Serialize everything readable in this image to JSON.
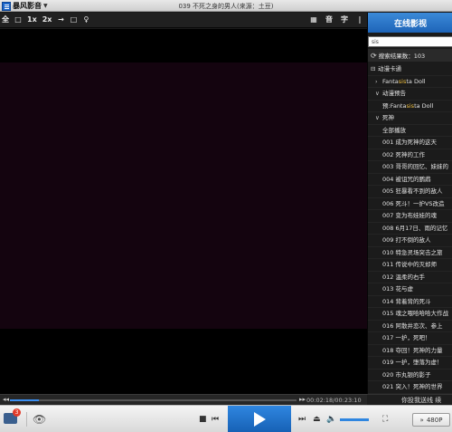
{
  "app": {
    "name": "暴风影音",
    "window_title": "039 不死之身的男人(来源：土豆)"
  },
  "toolbar": {
    "left": [
      "全",
      "□",
      "1x",
      "2x",
      "→",
      "□",
      "♀"
    ],
    "right": [
      "▦",
      "音",
      "字",
      "|"
    ]
  },
  "sidebar": {
    "online_button": "在线影视",
    "search_value": "sis",
    "result_text": "搜索结果数：103",
    "list": [
      {
        "type": "cat",
        "arrow": "⊟",
        "label": "动漫卡通"
      },
      {
        "type": "sub",
        "arrow": "›",
        "pre": "Fanta",
        "hl": "sis",
        "post": "ta Doll"
      },
      {
        "type": "sub",
        "arrow": "∨",
        "label": "动漫预告"
      },
      {
        "type": "item",
        "arrow": "",
        "pre": "预:Fanta",
        "hl": "sis",
        "post": "ta Doll"
      },
      {
        "type": "sub",
        "arrow": "∨",
        "label": "死神"
      },
      {
        "type": "item",
        "arrow": "",
        "label": "全部播放"
      },
      {
        "type": "ep",
        "label": "001 成为死神的这天"
      },
      {
        "type": "ep",
        "label": "002 死神的工作"
      },
      {
        "type": "ep",
        "label": "003 哥哥的回忆、妹妹的"
      },
      {
        "type": "ep",
        "label": "004 被诅咒的鹦鹉"
      },
      {
        "type": "ep",
        "label": "005 狂暴看不到的敌人"
      },
      {
        "type": "ep",
        "label": "006 死斗！一护VS改造"
      },
      {
        "type": "ep",
        "label": "007 变为布娃娃的魂"
      },
      {
        "type": "ep",
        "label": "008 6月17日、雨的记忆"
      },
      {
        "type": "ep",
        "label": "009 打不倒的敌人"
      },
      {
        "type": "ep",
        "label": "010 特急灵场突击之旅"
      },
      {
        "type": "ep",
        "label": "011 传说中的灭却师"
      },
      {
        "type": "ep",
        "label": "012 温柔的右手"
      },
      {
        "type": "ep",
        "label": "013 花与虚"
      },
      {
        "type": "ep",
        "label": "014 背着背的死斗"
      },
      {
        "type": "ep",
        "label": "015 魂之喂哈哈哈大作战"
      },
      {
        "type": "ep",
        "label": "016 阿散井恋次、参上"
      },
      {
        "type": "ep",
        "label": "017 一护，死吧！"
      },
      {
        "type": "ep",
        "label": "018 夺回！死神的力量"
      },
      {
        "type": "ep",
        "label": "019 一护，堕落为虚！"
      },
      {
        "type": "ep",
        "label": "020 市丸银的影子"
      },
      {
        "type": "ep",
        "label": "021 突入！死神的世界"
      }
    ]
  },
  "progress": {
    "time": "00:02:18/00:23:10",
    "played_fraction": 0.1
  },
  "playlist_footer": "你投我送线 续",
  "bottom": {
    "badge_count": "3",
    "quality": "480P",
    "quality_icon": "»",
    "volume_fraction": 1.0
  },
  "colors": {
    "accent": "#2f86e0",
    "highlight": "#f0c040",
    "video_bg": "#14040f"
  }
}
